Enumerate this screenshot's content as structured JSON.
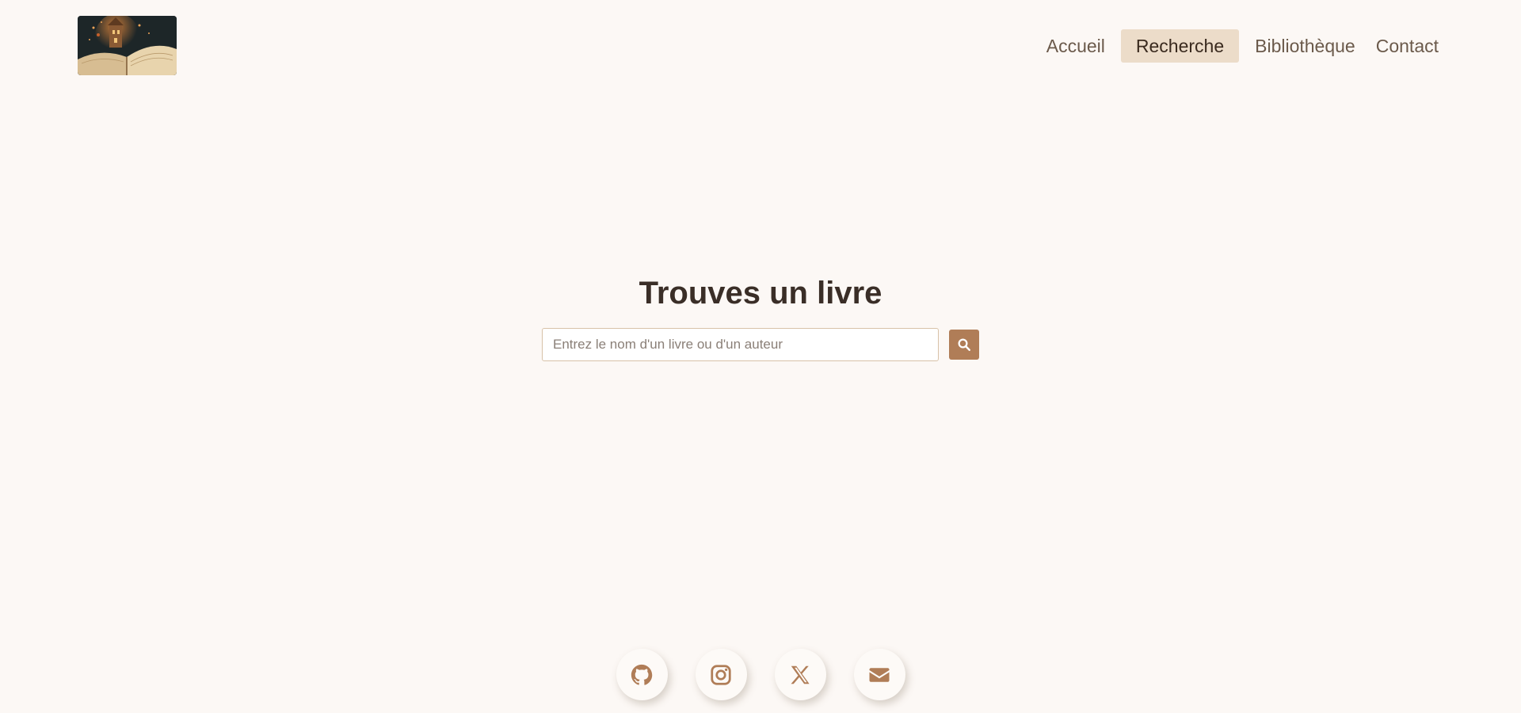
{
  "header": {
    "logo_alt": "book-castle-logo",
    "nav": [
      {
        "label": "Accueil",
        "active": false
      },
      {
        "label": "Recherche",
        "active": true
      },
      {
        "label": "Bibliothèque",
        "active": false
      },
      {
        "label": "Contact",
        "active": false
      }
    ]
  },
  "search": {
    "title": "Trouves un livre",
    "placeholder": "Entrez le nom d'un livre ou d'un auteur",
    "value": "",
    "button_icon": "search-icon"
  },
  "social": [
    {
      "name": "github",
      "icon": "github-icon"
    },
    {
      "name": "instagram",
      "icon": "instagram-icon"
    },
    {
      "name": "x",
      "icon": "x-icon"
    },
    {
      "name": "email",
      "icon": "envelope-icon"
    }
  ],
  "colors": {
    "background": "#fcf8f5",
    "accent": "#b07d57",
    "nav_active_bg": "#ecdcc9",
    "text_dark": "#3a2e27",
    "nav_text": "#6b5a4b"
  }
}
